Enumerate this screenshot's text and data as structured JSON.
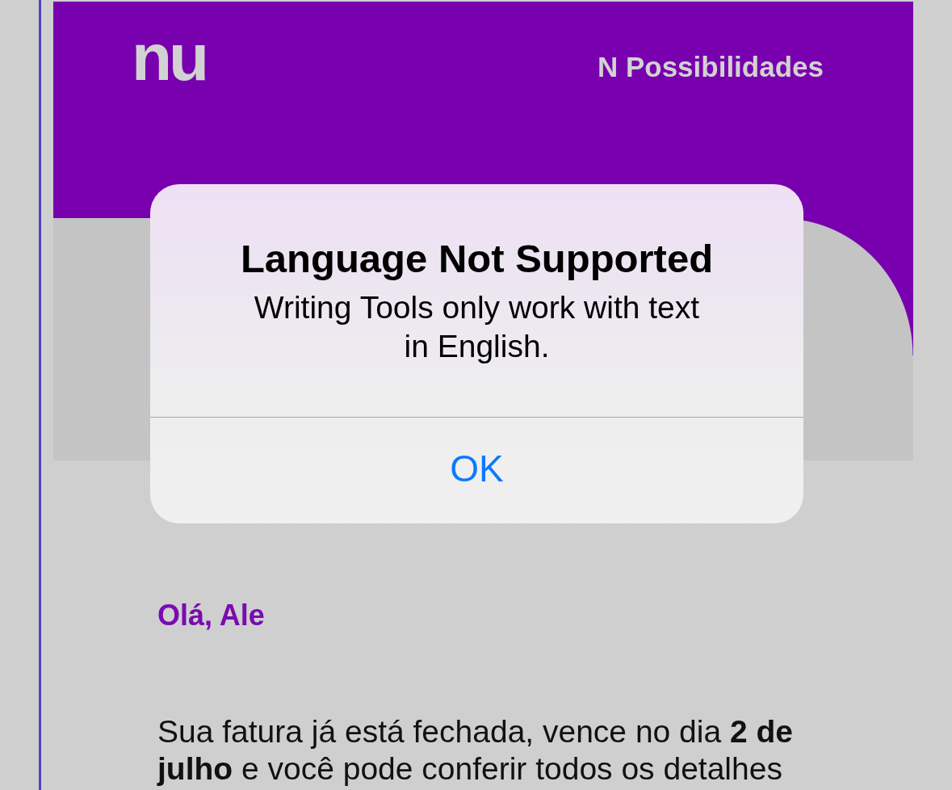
{
  "email": {
    "header": {
      "logo": "nu",
      "tagline": "N Possibilidades"
    },
    "greeting": "Olá, Ale",
    "body": "Sua fatura já está fechada, vence no dia **2 de julho** e você pode conferir todos os detalhes"
  },
  "alert": {
    "title": "Language Not Supported",
    "message": "Writing Tools only work with text in English.",
    "buttons": [
      "OK"
    ]
  }
}
